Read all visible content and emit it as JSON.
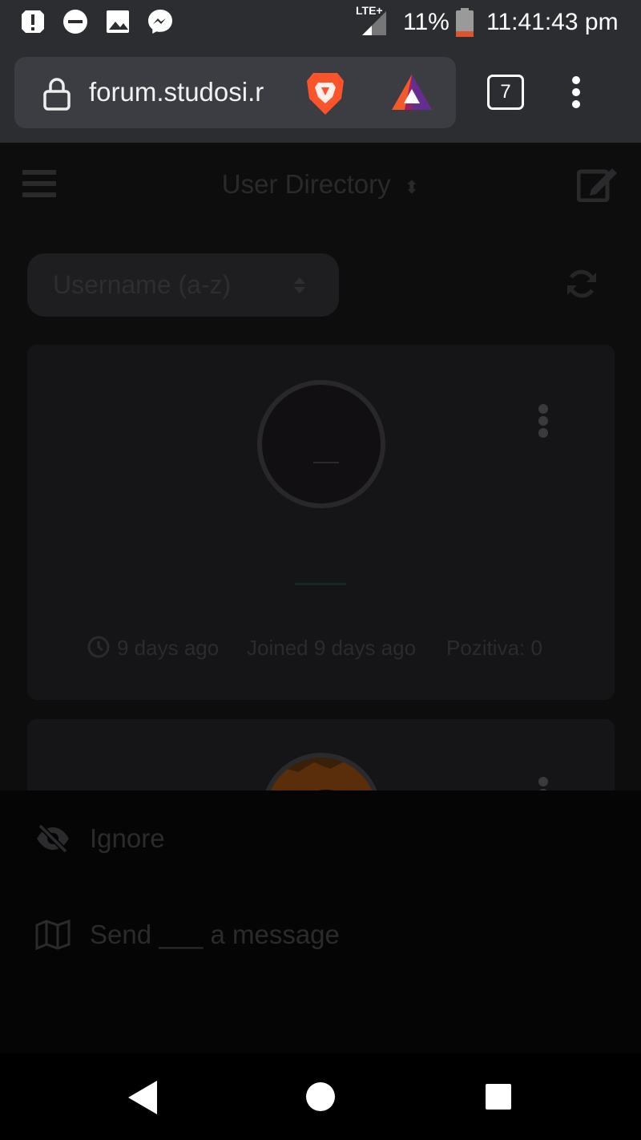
{
  "status_bar": {
    "notifications": [
      "alert-icon",
      "do-not-disturb-icon",
      "image-icon",
      "messenger-icon"
    ],
    "network": "LTE+",
    "battery_percent": "11%",
    "battery_color": "#e0542c",
    "time": "11:41:43 pm"
  },
  "browser": {
    "url": "forum.studosi.r",
    "tab_count": "7",
    "brave_color": "#fb542b"
  },
  "page": {
    "title": "User Directory",
    "sort_option": "Username (a-z)",
    "users": [
      {
        "last_seen": "9 days ago",
        "joined": "Joined 9 days ago",
        "reputation": "Pozitiva: 0"
      }
    ]
  },
  "menu": {
    "items": [
      {
        "label": "Ignore",
        "icon": "eye-slash-icon"
      },
      {
        "label": "Send ___ a message",
        "icon": "map-icon"
      }
    ]
  },
  "nav": {
    "buttons": [
      "back-button",
      "home-button",
      "recents-button"
    ]
  }
}
